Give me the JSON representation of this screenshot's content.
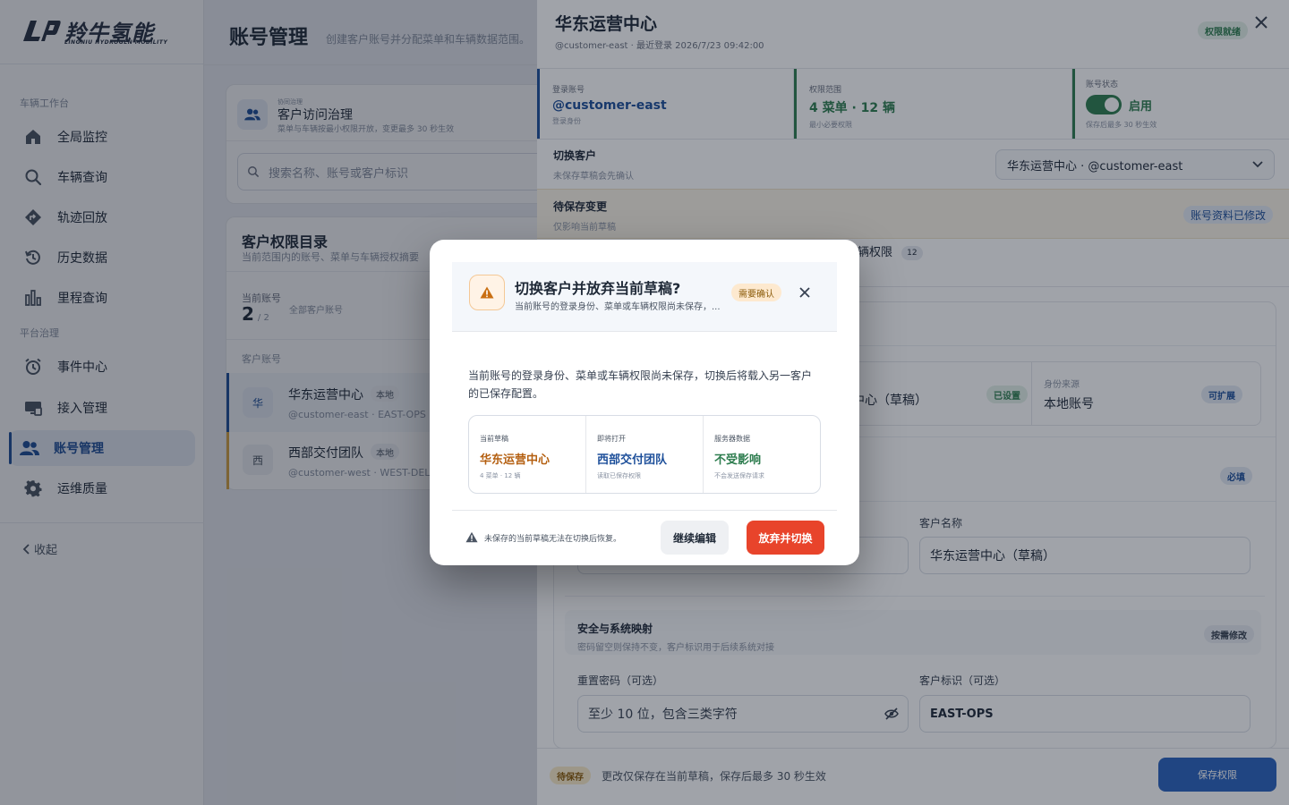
{
  "brand": {
    "name_cn": "羚牛氢能",
    "name_en": "LINGNIU HYDROGEN MOBILITY"
  },
  "sidebar": {
    "section_vehicle": "车辆工作台",
    "section_platform": "平台治理",
    "items": [
      {
        "label": "全局监控",
        "icon": "home-icon"
      },
      {
        "label": "车辆查询",
        "icon": "search-icon"
      },
      {
        "label": "轨迹回放",
        "icon": "route-icon"
      },
      {
        "label": "历史数据",
        "icon": "history-icon"
      },
      {
        "label": "里程查询",
        "icon": "bar-chart-icon"
      },
      {
        "label": "事件中心",
        "icon": "alarm-clock-icon"
      },
      {
        "label": "接入管理",
        "icon": "monitor-icon"
      },
      {
        "label": "账号管理",
        "icon": "users-icon",
        "active": true
      },
      {
        "label": "运维质量",
        "icon": "gear-icon"
      }
    ],
    "collapse_label": "收起"
  },
  "page": {
    "title": "账号管理",
    "subtitle": "创建客户账号并分配菜单和车辆数据范围。"
  },
  "governance": {
    "eyebrow": "协同治理",
    "title": "客户访问治理",
    "desc": "菜单与车辆按最小权限开放，变更最多 30 秒生效"
  },
  "search": {
    "placeholder": "搜索名称、账号或客户标识"
  },
  "directory": {
    "title": "客户权限目录",
    "desc": "当前范围内的账号、菜单与车辆授权摘要",
    "count_label": "当前账号",
    "count_value": "2",
    "count_total": "/ 2",
    "count_scope": "全部客户账号",
    "list_label": "客户账号",
    "items": [
      {
        "avatar": "华",
        "name": "华东运营中心",
        "badge": "本地",
        "sub": "@customer-east · EAST-OPS",
        "color": "#1d4f9a"
      },
      {
        "avatar": "西",
        "name": "西部交付团队",
        "badge": "本地",
        "sub": "@customer-west · WEST-DEL",
        "color": "#d9a441"
      }
    ]
  },
  "drawer": {
    "title": "华东运营中心",
    "meta": "@customer-east · 最近登录 2026/7/23 09:42:00",
    "status_pill": "权限就绪",
    "stats": [
      {
        "label": "登录账号",
        "value": "@customer-east",
        "sub": "登录身份",
        "accent": "#1d4f9a"
      },
      {
        "label": "权限范围",
        "value": "4 菜单 · 12 辆",
        "sub": "最小必要权限",
        "accent": "#2e7d4f"
      },
      {
        "label": "账号状态",
        "value": "启用",
        "sub": "保存后最多 30 秒生效",
        "accent": "#2e7d4f"
      }
    ],
    "switch_label": "切换客户",
    "switch_sub": "未保存草稿会先确认",
    "switch_value": "华东运营中心 · @customer-east",
    "pending_title": "待保存变更",
    "pending_sub": "仅影响当前草稿",
    "pending_badge": "账号资料已修改",
    "tab_vehicle_label": "辆权限",
    "tab_vehicle_count": "12",
    "identity_value_partial": "中心（草稿）",
    "identity_value_badge": "已设置",
    "identity_source_label": "身份来源",
    "identity_source_value": "本地账号",
    "identity_source_badge": "可扩展",
    "required_badge": "必填",
    "customer_name_label": "客户名称",
    "customer_name_value": "华东运营中心（草稿）",
    "security_title": "安全与系统映射",
    "security_desc": "密码留空则保持不变，客户标识用于后续系统对接",
    "security_badge": "按需修改",
    "password_label": "重置密码（可选）",
    "password_placeholder": "至少 10 位，包含三类字符",
    "customer_id_label": "客户标识（可选）",
    "customer_id_value": "EAST-OPS",
    "footer_badge": "待保存",
    "footer_text": "更改仅保存在当前草稿，保存后最多 30 秒生效",
    "save_label": "保存权限"
  },
  "modal": {
    "title": "切换客户并放弃当前草稿?",
    "subtitle": "当前账号的登录身份、菜单或车辆权限尚未保存，...",
    "badge": "需要确认",
    "body": "当前账号的登录身份、菜单或车辆权限尚未保存，切换后将载入另一客户的已保存配置。",
    "cells": [
      {
        "label": "当前草稿",
        "value": "华东运营中心",
        "sub": "4 菜单 · 12 辆",
        "color": "#b45f10"
      },
      {
        "label": "即将打开",
        "value": "西部交付团队",
        "sub": "读取已保存权限",
        "color": "#1d4f9a"
      },
      {
        "label": "服务器数据",
        "value": "不受影响",
        "sub": "不会发送保存请求",
        "color": "#2e7d4f"
      }
    ],
    "footer_note": "未保存的当前草稿无法在切换后恢复。",
    "cancel_label": "继续编辑",
    "confirm_label": "放弃并切换"
  },
  "colors": {
    "primary": "#1d4f9a",
    "success": "#2e7d4f",
    "warning": "#b45f10",
    "danger": "#e8442b"
  }
}
